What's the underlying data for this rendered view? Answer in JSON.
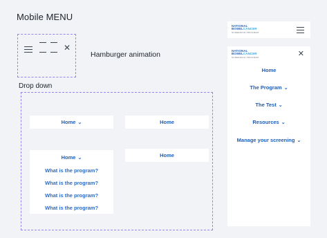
{
  "page_title": "Mobile MENU",
  "hamburger_label": "Hamburger animation",
  "dropdown_label": "Drop down",
  "dropdown": {
    "card1_label": "Home",
    "card2_label": "Home",
    "card3_label": "Home",
    "card4_label": "Home",
    "subitems": [
      "What is the program?",
      "What is the program?",
      "What is the program?",
      "What is the program?"
    ]
  },
  "logo": {
    "line1": "NATIONAL",
    "line2_a": "BOWEL",
    "line2_b": "CANCER",
    "line3": "SCREENING PROGRAM"
  },
  "mobile_menu": {
    "items": [
      "Home",
      "The Program",
      "The Test",
      "Resources",
      "Manage your screening"
    ]
  },
  "colors": {
    "accent": "#1e5db8",
    "dashed_border": "#8f86f0",
    "background": "#f1f3f6"
  }
}
